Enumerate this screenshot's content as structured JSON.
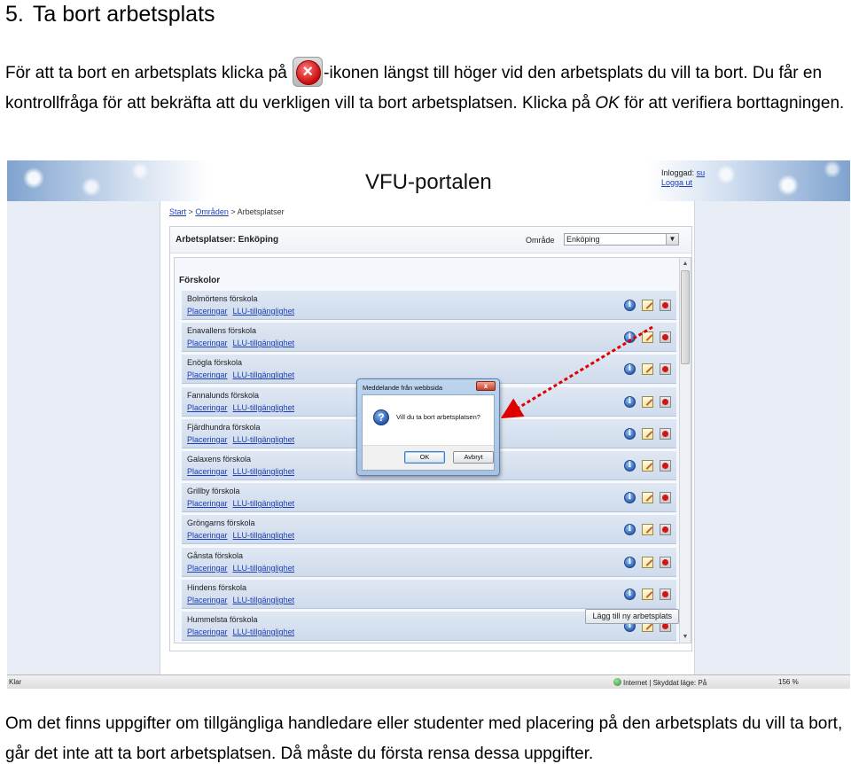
{
  "document": {
    "heading_number": "5.",
    "heading_text": "Ta bort arbetsplats",
    "intro_before_icon": "För att ta bort en arbetsplats klicka på",
    "intro_after_icon": "-ikonen längst till höger vid den arbetsplats du vill ta bort. Du får en kontrollfråga för att bekräfta att du verkligen vill ta bort arbetsplatsen. Klicka på",
    "intro_emphasis": "OK",
    "intro_end": "för att verifiera borttagningen.",
    "outro": "Om det finns uppgifter om tillgängliga handledare eller studenter med placering på den arbetsplats du vill ta bort, går det inte att ta bort arbetsplatsen. Då måste du första rensa dessa uppgifter."
  },
  "portal": {
    "title": "VFU-portalen",
    "login_label": "Inloggad:",
    "login_user": "su",
    "logout": "Logga ut",
    "breadcrumb": {
      "start": "Start",
      "sep1": ">",
      "areas": "Områden",
      "sep2": ">",
      "current": "Arbetsplatser"
    },
    "panel_title": "Arbetsplatser: Enköping",
    "area_label": "Område",
    "area_value": "Enköping",
    "section_heading": "Förskolor",
    "link_placements": "Placeringar",
    "link_availability": "LLU-tillgänglighet",
    "rows": [
      {
        "name": "Bolmörtens förskola"
      },
      {
        "name": "Enavallens förskola"
      },
      {
        "name": "Enögla förskola"
      },
      {
        "name": "Fannalunds förskola"
      },
      {
        "name": "Fjärdhundra förskola"
      },
      {
        "name": "Galaxens förskola"
      },
      {
        "name": "Grillby förskola"
      },
      {
        "name": "Gröngarns förskola"
      },
      {
        "name": "Gånsta förskola"
      },
      {
        "name": "Hindens förskola"
      },
      {
        "name": "Hummelsta förskola"
      }
    ],
    "add_button": "Lägg till ny arbetsplats",
    "status_left": "Klar",
    "status_zone": "Internet | Skyddat läge: På",
    "status_zoom": "156 %"
  },
  "dialog": {
    "title": "Meddelande från webbsida",
    "close_glyph": "x",
    "message": "Vill du ta bort arbetsplatsen?",
    "ok": "OK",
    "cancel": "Avbryt"
  },
  "icons": {
    "inline_icon": "delete-x-icon",
    "row_icons": [
      "info-icon",
      "edit-icon",
      "delete-icon"
    ],
    "dialog_icon": "question-icon"
  },
  "colors": {
    "link": "#1d3fb5",
    "row_bg": "#d6e0ef",
    "arrow": "#e00000"
  }
}
